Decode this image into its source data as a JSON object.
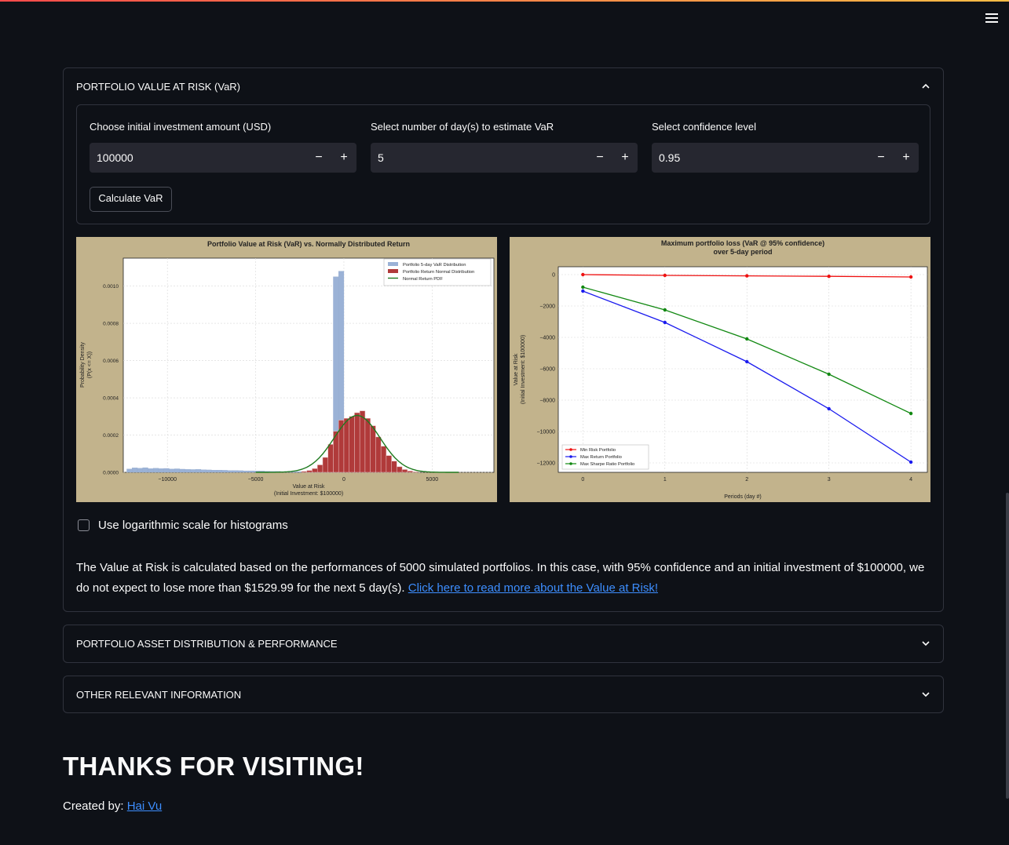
{
  "sections": {
    "var": {
      "title": "PORTFOLIO VALUE AT RISK (VaR)",
      "inputs": [
        {
          "label": "Choose initial investment amount (USD)",
          "value": "100000"
        },
        {
          "label": "Select number of day(s) to estimate VaR",
          "value": "5"
        },
        {
          "label": "Select confidence level",
          "value": "0.95"
        }
      ],
      "minus": "−",
      "plus": "+",
      "calculate_label": "Calculate VaR",
      "checkbox_label": "Use logarithmic scale for histograms",
      "checkbox_checked": false,
      "description": "The Value at Risk is calculated based on the performances of 5000 simulated portfolios. In this case, with 95% confidence and an initial investment of $100000, we do not expect to lose more than $1529.99 for the next 5 day(s). ",
      "link_text": "Click here to read more about the Value at Risk!"
    },
    "asset": {
      "title": "PORTFOLIO ASSET DISTRIBUTION & PERFORMANCE"
    },
    "other": {
      "title": "OTHER RELEVANT INFORMATION"
    }
  },
  "footer": {
    "thanks": "THANKS FOR VISITING!",
    "created_by": "Created by: ",
    "author": "Hai Vu"
  },
  "colors": {
    "background": "#0e1117",
    "link": "#3d8eff",
    "chart_bg": "#c2b38c"
  },
  "chart_data": [
    {
      "type": "bar",
      "title": "Portfolio Value at Risk (VaR) vs. Normally Distributed Return",
      "xlabel": "Value at Risk\n(Initial Investment: $100000)",
      "ylabel": "Probability Density\n(P(x <= X))",
      "xlim": [
        -12500,
        8500
      ],
      "ylim": [
        0,
        0.00115
      ],
      "xticks": [
        -10000,
        -5000,
        0,
        5000
      ],
      "xtick_labels": [
        "−10000",
        "−5000",
        "0",
        "5000"
      ],
      "yticks": [
        0,
        0.0002,
        0.0004,
        0.0006,
        0.0008,
        0.001
      ],
      "ytick_labels": [
        "0.0000",
        "0.0002",
        "0.0004",
        "0.0006",
        "0.0008",
        "0.0010"
      ],
      "legend": [
        "Portfolio 5-day VaR Distribution",
        "Portfolio Return Normal Distribution",
        "Normal Return PDF"
      ],
      "legend_position": "upper-right",
      "grid": true,
      "series": [
        {
          "name": "Portfolio 5-day VaR Distribution",
          "color": "#9bb2d6",
          "bin_width": 300,
          "bins": [
            [
              -12300,
              1.8e-05
            ],
            [
              -12000,
              2.4e-05
            ],
            [
              -11700,
              2.2e-05
            ],
            [
              -11400,
              2.5e-05
            ],
            [
              -11100,
              2e-05
            ],
            [
              -10800,
              2.2e-05
            ],
            [
              -10500,
              2e-05
            ],
            [
              -10200,
              2.1e-05
            ],
            [
              -9900,
              1.8e-05
            ],
            [
              -9600,
              1.9e-05
            ],
            [
              -9300,
              1.7e-05
            ],
            [
              -9000,
              1.6e-05
            ],
            [
              -8700,
              1.5e-05
            ],
            [
              -8400,
              1.6e-05
            ],
            [
              -8100,
              1.4e-05
            ],
            [
              -7800,
              1.3e-05
            ],
            [
              -7500,
              1.2e-05
            ],
            [
              -7200,
              1.2e-05
            ],
            [
              -6900,
              1.1e-05
            ],
            [
              -6600,
              1e-05
            ],
            [
              -6300,
              1e-05
            ],
            [
              -6000,
              9e-06
            ],
            [
              -5700,
              8e-06
            ],
            [
              -5400,
              8e-06
            ],
            [
              -5100,
              7e-06
            ],
            [
              -4800,
              7e-06
            ],
            [
              -4500,
              6e-06
            ],
            [
              -4200,
              5e-06
            ],
            [
              -3900,
              5e-06
            ],
            [
              -3600,
              4e-06
            ],
            [
              -3300,
              4e-06
            ],
            [
              -3000,
              3e-06
            ],
            [
              -2700,
              4e-06
            ],
            [
              -2400,
              5e-06
            ],
            [
              -2100,
              7e-06
            ],
            [
              -1800,
              1e-05
            ],
            [
              -1500,
              2e-05
            ],
            [
              -1200,
              4e-05
            ],
            [
              -900,
              8e-05
            ],
            [
              -600,
              0.00105
            ],
            [
              -300,
              0.00108
            ]
          ]
        },
        {
          "name": "Portfolio Return Normal Distribution",
          "color": "#b03a3a",
          "bin_width": 300,
          "bins": [
            [
              -2400,
              5e-06
            ],
            [
              -2100,
              1e-05
            ],
            [
              -1800,
              2e-05
            ],
            [
              -1500,
              4e-05
            ],
            [
              -1200,
              8e-05
            ],
            [
              -900,
              0.00015
            ],
            [
              -600,
              0.00022
            ],
            [
              -300,
              0.00028
            ],
            [
              0,
              0.00029
            ],
            [
              300,
              0.0003
            ],
            [
              600,
              0.00032
            ],
            [
              900,
              0.00033
            ],
            [
              1200,
              0.00029
            ],
            [
              1500,
              0.00025
            ],
            [
              1800,
              0.00019
            ],
            [
              2100,
              0.00014
            ],
            [
              2400,
              9e-05
            ],
            [
              2700,
              6e-05
            ],
            [
              3000,
              3e-05
            ],
            [
              3300,
              1.5e-05
            ],
            [
              3600,
              7e-06
            ],
            [
              3900,
              3e-06
            ]
          ]
        },
        {
          "name": "Normal Return PDF",
          "color": "#1f7a1f",
          "mean": 750,
          "std": 1300,
          "peak": 0.000305
        }
      ]
    },
    {
      "type": "line",
      "title": "Maximum portfolio loss (VaR @ 95% confidence)\nover 5-day period",
      "xlabel": "Periods (day #)",
      "ylabel": "Value at Risk\n(Initial Investment: $100000)",
      "xlim": [
        -0.3,
        4.2
      ],
      "ylim": [
        -12600,
        500
      ],
      "xticks": [
        0,
        1,
        2,
        3,
        4
      ],
      "yticks": [
        0,
        -2000,
        -4000,
        -6000,
        -8000,
        -10000,
        -12000
      ],
      "ytick_labels": [
        "0",
        "−2000",
        "−4000",
        "−6000",
        "−8000",
        "−10000",
        "−12000"
      ],
      "legend_position": "lower-left",
      "grid": true,
      "x": [
        0,
        1,
        2,
        3,
        4
      ],
      "series": [
        {
          "name": "Min Risk Portfolio",
          "color": "#ee1111",
          "values": [
            0,
            -50,
            -80,
            -110,
            -150
          ]
        },
        {
          "name": "Max Return Portfolio",
          "color": "#1a1aee",
          "values": [
            -1050,
            -3050,
            -5550,
            -8550,
            -11950
          ]
        },
        {
          "name": "Max Sharpe Ratio Portfolio",
          "color": "#118811",
          "values": [
            -800,
            -2250,
            -4100,
            -6350,
            -8850
          ]
        }
      ]
    }
  ]
}
